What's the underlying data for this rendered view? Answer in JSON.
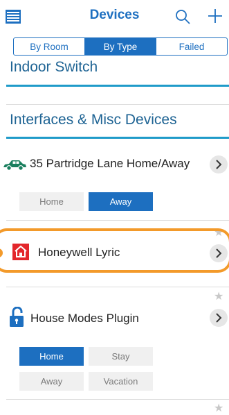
{
  "header": {
    "title": "Devices",
    "menu_icon": "hamburger-list-icon",
    "search_icon": "search-icon",
    "add_icon": "plus-icon"
  },
  "tabs": [
    {
      "label": "By Room",
      "active": false
    },
    {
      "label": "By Type",
      "active": true
    },
    {
      "label": "Failed",
      "active": false
    }
  ],
  "sections": {
    "indoor_switch": "Indoor Switch",
    "interfaces": "Interfaces & Misc Devices"
  },
  "devices": [
    {
      "name": "35 Partridge Lane Home/Away",
      "icon": "car-icon",
      "modes": [
        {
          "label": "Home",
          "active": false
        },
        {
          "label": "Away",
          "active": true
        }
      ]
    },
    {
      "name": "Honeywell Lyric",
      "icon": "honeywell-house-icon"
    },
    {
      "name": "House Modes Plugin",
      "icon": "lock-icon",
      "modes": [
        {
          "label": "Home",
          "active": true
        },
        {
          "label": "Stay",
          "active": false
        },
        {
          "label": "Away",
          "active": false
        },
        {
          "label": "Vacation",
          "active": false
        }
      ]
    }
  ],
  "colors": {
    "accent": "#1d6fc0",
    "section_text": "#1f6494",
    "section_rule": "#1f9bc9",
    "highlight": "#f39a2a",
    "honeywell_red": "#e3262b"
  }
}
